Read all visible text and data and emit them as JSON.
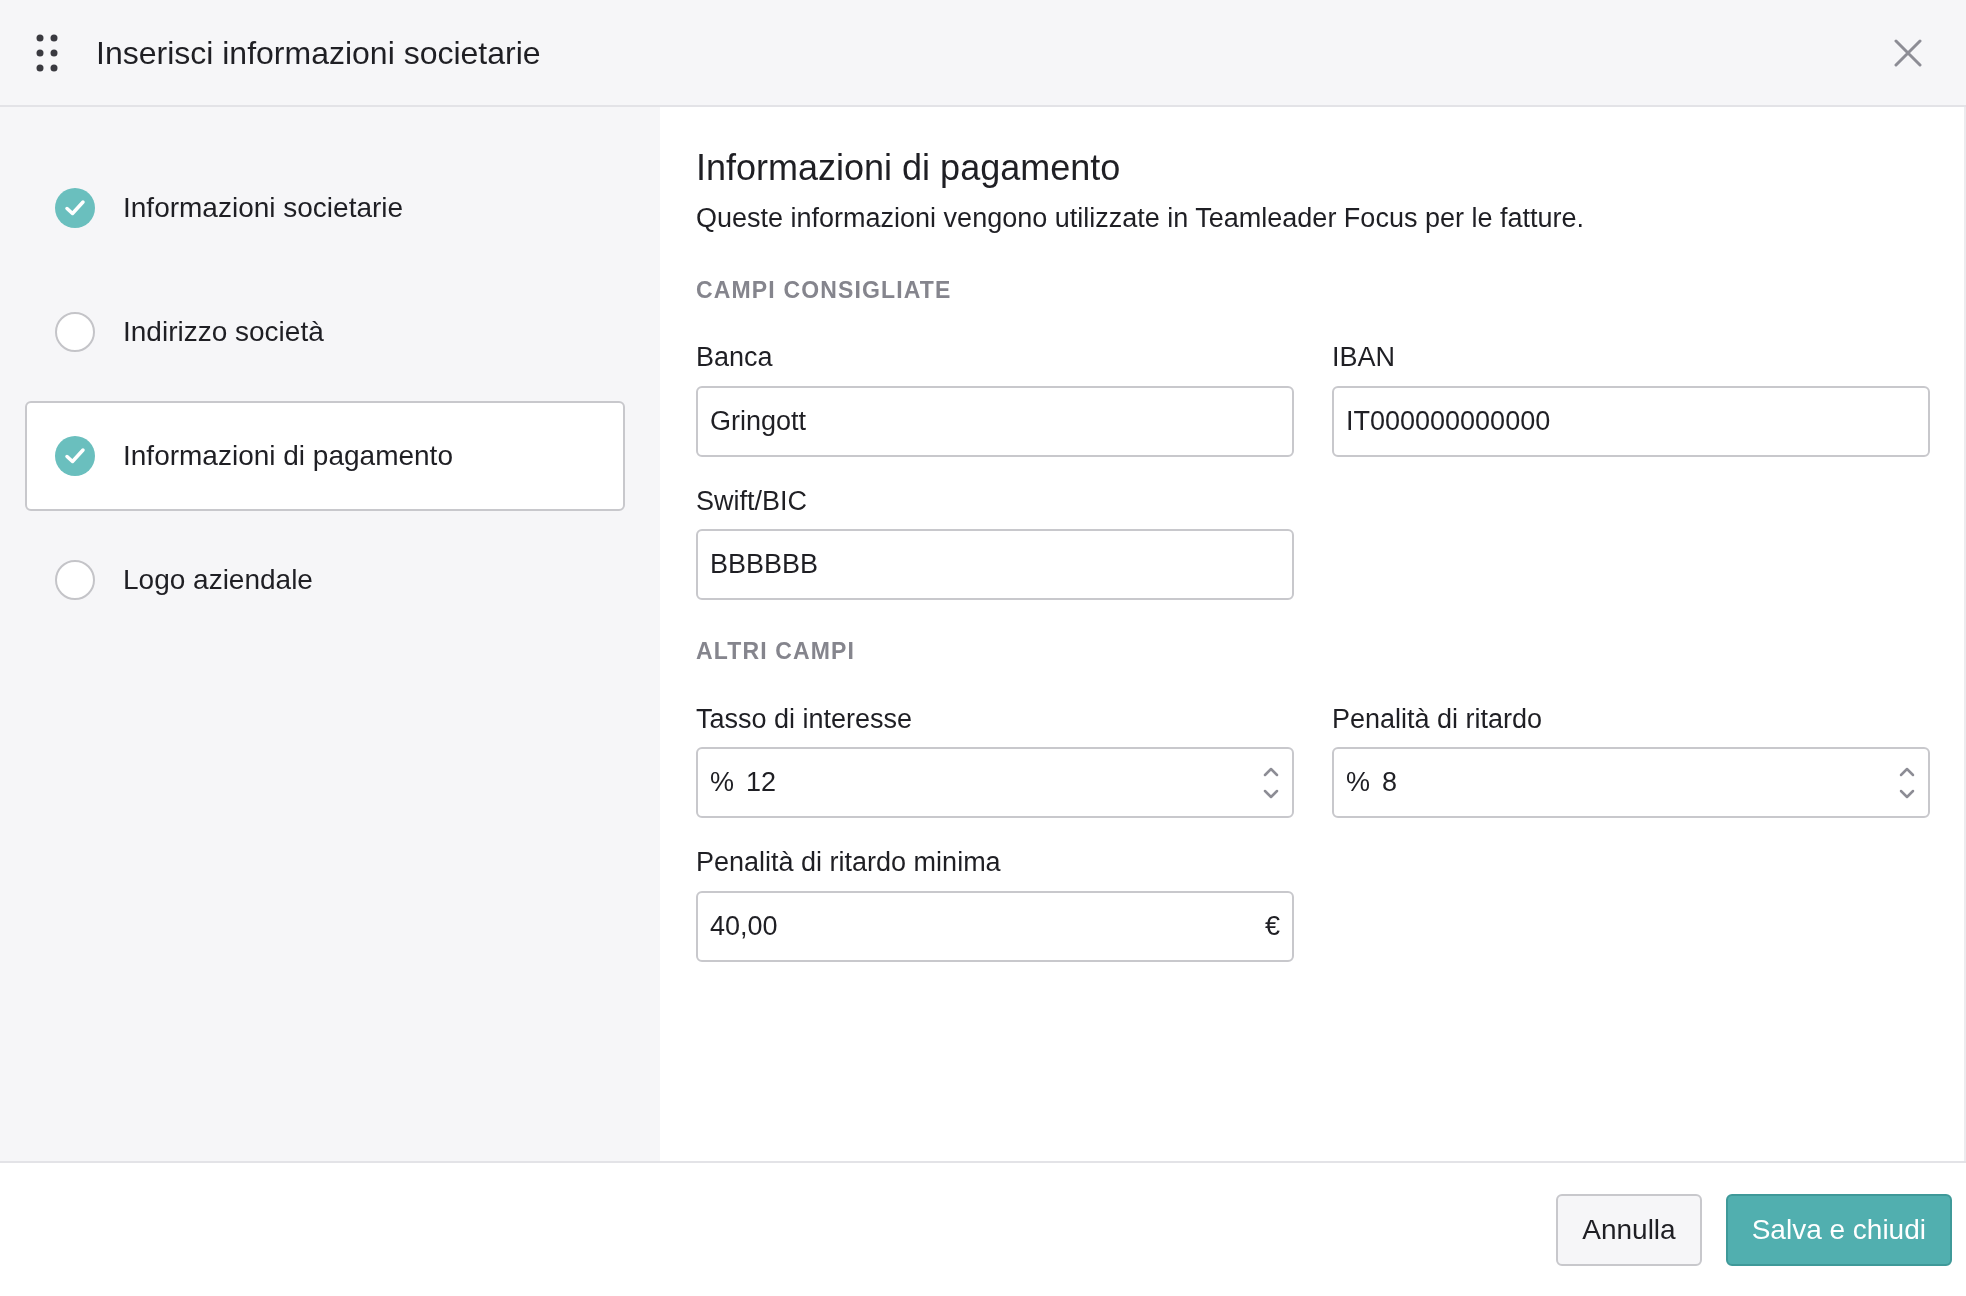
{
  "window": {
    "title": "Inserisci informazioni societarie"
  },
  "steps": [
    {
      "label": "Informazioni societarie",
      "checked": true,
      "selected": false
    },
    {
      "label": "Indirizzo società",
      "checked": false,
      "selected": false
    },
    {
      "label": "Informazioni di pagamento",
      "checked": true,
      "selected": true
    },
    {
      "label": "Logo aziendale",
      "checked": false,
      "selected": false
    }
  ],
  "content": {
    "title": "Informazioni di pagamento",
    "description": "Queste informazioni vengono utilizzate in Teamleader Focus per le fatture.",
    "sections": [
      {
        "heading": "CAMPI CONSIGLIATE",
        "fields": [
          {
            "kind": "text",
            "label": "Banca",
            "value": "Gringott"
          },
          {
            "kind": "text",
            "label": "IBAN",
            "value": "IT000000000000"
          },
          {
            "kind": "text",
            "label": "Swift/BIC",
            "value": "BBBBBB"
          }
        ]
      },
      {
        "heading": "ALTRI CAMPI",
        "fields": [
          {
            "kind": "number",
            "label": "Tasso di interesse",
            "prefix": "%",
            "value": "12"
          },
          {
            "kind": "number",
            "label": "Penalità di ritardo",
            "prefix": "%",
            "value": "8"
          },
          {
            "kind": "currency",
            "label": "Penalità di ritardo minima",
            "value": "40,00",
            "suffix": "€"
          }
        ]
      }
    ]
  },
  "footer": {
    "buttons": [
      {
        "kind": "secondary",
        "label": "Annulla"
      },
      {
        "kind": "primary",
        "label": "Salva e chiudi"
      }
    ]
  }
}
